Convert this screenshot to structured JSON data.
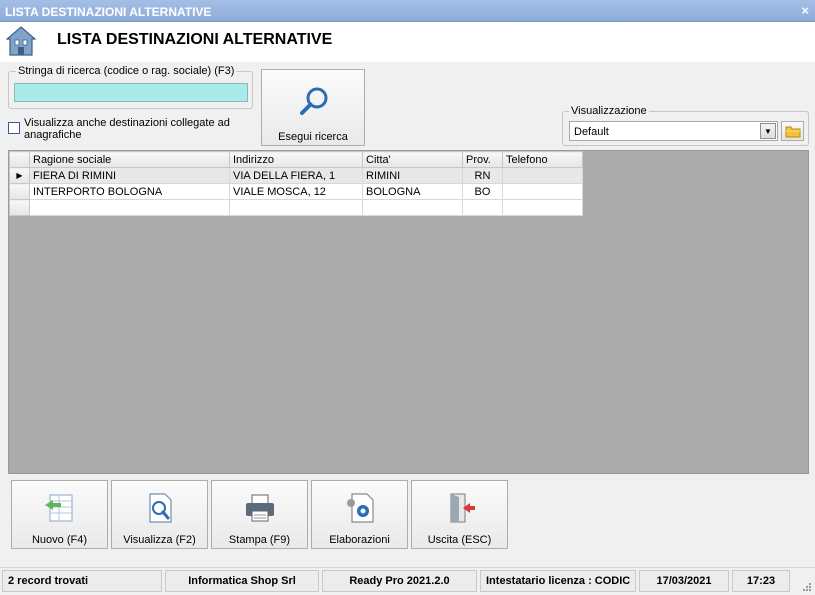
{
  "window": {
    "title": "LISTA DESTINAZIONI ALTERNATIVE",
    "close_glyph": "×"
  },
  "header": {
    "title": "LISTA DESTINAZIONI ALTERNATIVE",
    "icon": "home-icon"
  },
  "search": {
    "legend": "Stringa di ricerca (codice o rag. sociale) (F3)",
    "value": "",
    "highlight_color": "#a8ebeb",
    "checkbox_label": "Visualizza anche destinazioni collegate ad anagrafiche",
    "checkbox_checked": false,
    "button_label": "Esegui ricerca"
  },
  "visualization": {
    "legend": "Visualizzazione",
    "selected": "Default"
  },
  "table": {
    "columns": [
      "Ragione sociale",
      "Indirizzo",
      "Citta'",
      "Prov.",
      "Telefono"
    ],
    "rows": [
      {
        "indicator": "▶",
        "cells": [
          "FIERA DI RIMINI",
          "VIA DELLA FIERA, 1",
          "RIMINI",
          "RN",
          ""
        ]
      },
      {
        "indicator": "",
        "cells": [
          "INTERPORTO BOLOGNA",
          "VIALE MOSCA, 12",
          "BOLOGNA",
          "BO",
          ""
        ]
      },
      {
        "indicator": "",
        "cells": [
          "",
          "",
          "",
          "",
          ""
        ]
      }
    ]
  },
  "actions": [
    {
      "label": "Nuovo (F4)",
      "icon": "new-record-icon"
    },
    {
      "label": "Visualizza (F2)",
      "icon": "view-document-icon"
    },
    {
      "label": "Stampa (F9)",
      "icon": "printer-icon"
    },
    {
      "label": "Elaborazioni",
      "icon": "processing-gear-icon"
    },
    {
      "label": "Uscita (ESC)",
      "icon": "exit-door-icon"
    }
  ],
  "status": {
    "records": "2 record trovati",
    "company": "Informatica Shop Srl",
    "product": "Ready Pro 2021.2.0",
    "license": "Intestatario licenza : CODIC",
    "date": "17/03/2021",
    "time": "17:23"
  }
}
